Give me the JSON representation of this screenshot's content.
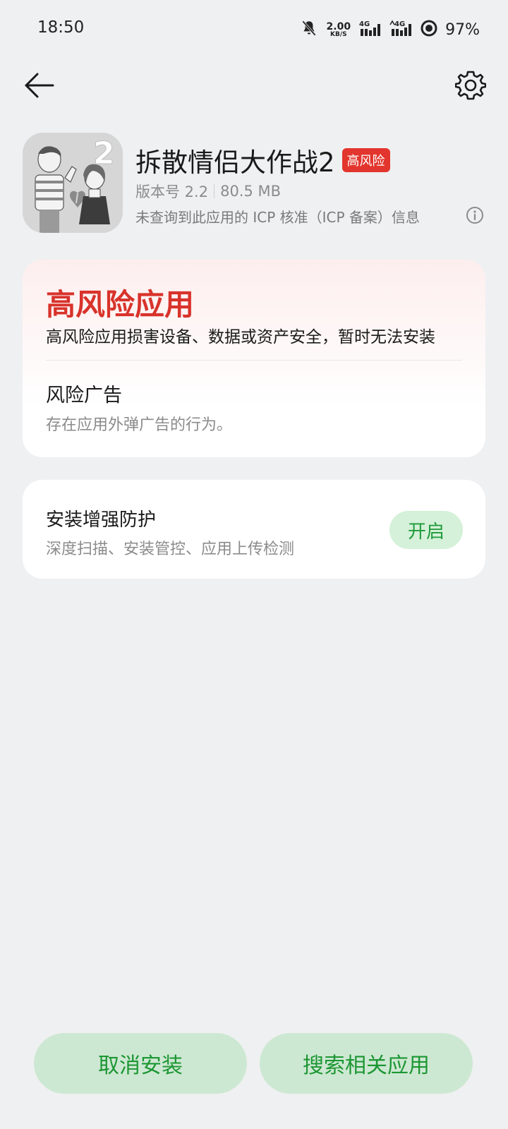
{
  "status_bar": {
    "time": "18:50",
    "net_speed_value": "2.00",
    "net_speed_unit": "KB/S",
    "signal1_label": "4G",
    "signal2_label": "4G",
    "battery": "97%"
  },
  "nav": {
    "back_icon": "arrow-left",
    "settings_icon": "gear"
  },
  "app": {
    "name": "拆散情侣大作战2",
    "risk_badge": "高风险",
    "version": "版本号 2.2",
    "size": "80.5 MB",
    "icp_notice": "未查询到此应用的 ICP 核准（ICP 备案）信息",
    "icon_overlay_number": "2"
  },
  "risk_card": {
    "title": "高风险应用",
    "description": "高风险应用损害设备、数据或资产安全，暂时无法安装",
    "ad_title": "风险广告",
    "ad_description": "存在应用外弹广告的行为。"
  },
  "protection_card": {
    "title": "安装增强防护",
    "description": "深度扫描、安装管控、应用上传检测",
    "button": "开启"
  },
  "bottom": {
    "cancel_button": "取消安装",
    "search_button": "搜索相关应用"
  },
  "colors": {
    "background": "#eff0f2",
    "risk_red": "#d8332b",
    "badge_red": "#e2352d",
    "green_text": "#1c9633",
    "green_button_bg": "#cde8d2"
  }
}
